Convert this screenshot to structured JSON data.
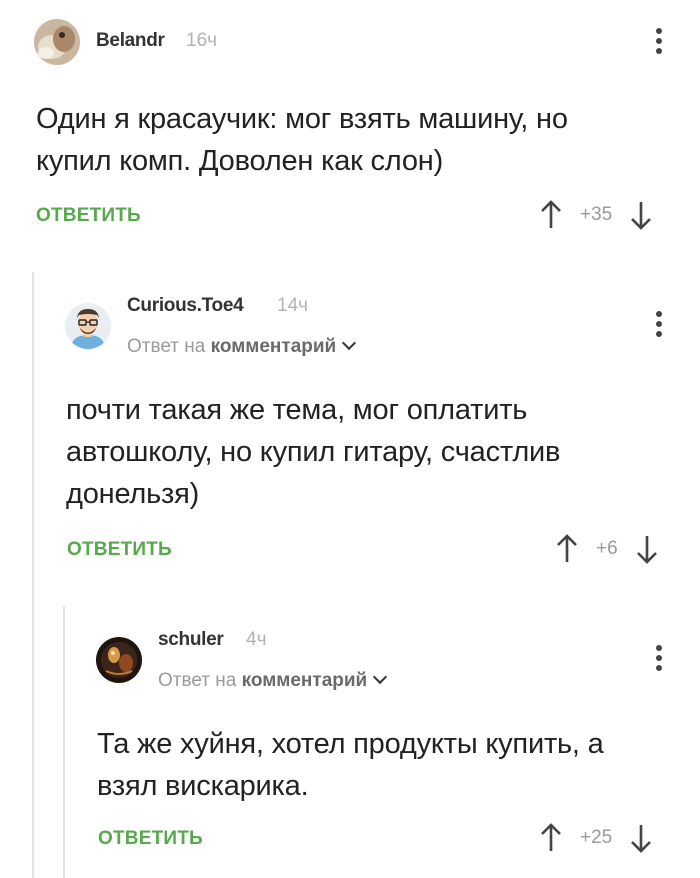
{
  "comments": [
    {
      "author": "Belandr",
      "time": "16ч",
      "text": "Один я красаучик: мог взять машину, но купил комп. Доволен как слон)",
      "reply_label": "ОТВЕТИТЬ",
      "score": "+35"
    },
    {
      "author": "Curious.Toe4",
      "time": "14ч",
      "reply_prefix": "Ответ на",
      "reply_target": "комментарий",
      "text": "почти такая же тема, мог оплатить автошколу, но купил гитару, счастлив донельзя)",
      "reply_label": "ОТВЕТИТЬ",
      "score": "+6"
    },
    {
      "author": "schuler",
      "time": "4ч",
      "reply_prefix": "Ответ на",
      "reply_target": "комментарий",
      "text": "Та же хуйня, хотел продукты купить, а взял вискарика.",
      "reply_label": "ОТВЕТИТЬ",
      "score": "+25"
    }
  ],
  "icons": {
    "vote_up": "arrow-up-icon",
    "vote_down": "arrow-down-icon",
    "more": "more-vertical-icon",
    "reply_expand": "chevron-down-icon"
  },
  "colors": {
    "reply_button": "#58a84d",
    "author": "#333333",
    "meta": "#9a9a9a",
    "thread_line": "#e3e3e3"
  }
}
